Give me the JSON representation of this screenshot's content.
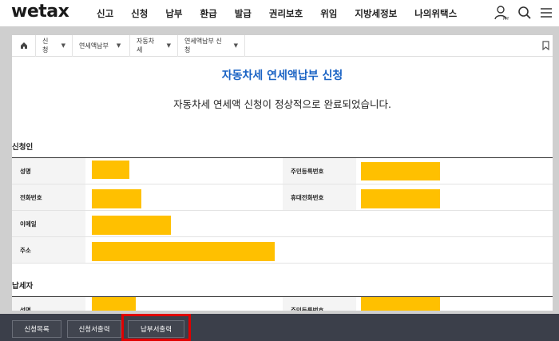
{
  "logo": "wetax",
  "menu": [
    "신고",
    "신청",
    "납부",
    "환급",
    "발급",
    "권리보호",
    "위임",
    "지방세정보",
    "나의위택스"
  ],
  "top_icons": [
    "user-my-icon",
    "search-icon",
    "menu-icon"
  ],
  "user_icon_label": "MY",
  "breadcrumb": {
    "home_icon": "home-icon",
    "items": [
      "신청",
      "연세액납부",
      "자동차세",
      "연세액납부 신청"
    ]
  },
  "page": {
    "title": "자동차세 연세액납부 신청",
    "message": "자동차세 연세액 신청이 정상적으로 완료되었습니다."
  },
  "applicant": {
    "heading": "신청인",
    "fields": {
      "name": "성명",
      "rrn": "주민등록번호",
      "phone": "전화번호",
      "mobile": "휴대전화번호",
      "email": "이메일",
      "address": "주소"
    }
  },
  "taxpayer": {
    "heading": "납세자",
    "fields": {
      "name": "성명",
      "rrn": "주민등록번호"
    }
  },
  "redaction_color": "#ffc000",
  "bottom_buttons": {
    "list": "신청목록",
    "print_application": "신청서출력",
    "print_payment": "납부서출력"
  },
  "highlight_color": "#e00000"
}
